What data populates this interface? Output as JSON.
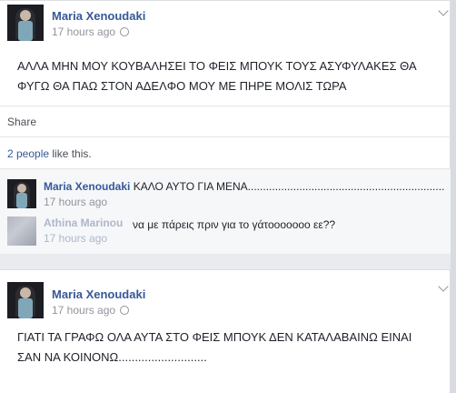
{
  "posts": [
    {
      "author": "Maria Xenoudaki",
      "time": "17 hours ago",
      "text": "ΑΛΛΑ ΜΗΝ ΜΟΥ ΚΟΥΒΑΛΗΣΕΙ ΤΟ ΦΕΙΣ ΜΠΟΥΚ ΤΟΥΣ ΑΣΥΦΥΛΑΚΕΣ ΘΑ\nΦΥΓΩ ΘΑ ΠΑΩ ΣΤΟΝ ΑΔΕΛΦΟ ΜΟΥ ΜΕ ΠΗΡΕ ΜΟΛΙΣ ΤΩΡΑ",
      "share_label": "Share",
      "likes_count": "2 people",
      "likes_suffix": " like this.",
      "comments": [
        {
          "author": "Maria Xenoudaki",
          "text": "ΚΑΛΟ ΑΥΤΟ ΓΙΑ ΜΕΝΑ.................................................................",
          "time": "17 hours ago"
        },
        {
          "author": "Athina Marinou",
          "text": "να με πάρεις πριν για το γάτοοοοοοο εε??",
          "time": "17 hours ago"
        }
      ]
    },
    {
      "author": "Maria Xenoudaki",
      "time": "17 hours ago",
      "text": "ΓΙΑΤΙ ΤΑ ΓΡΑΦΩ ΟΛΑ ΑΥΤΑ ΣΤΟ ΦΕΙΣ ΜΠΟΥΚ ΔΕΝ ΚΑΤΑΛΑΒΑΙΝΩ ΕΙΝΑΙ\nΣΑΝ ΝΑ ΚΟΙΝΟΝΩ..........................."
    }
  ],
  "icons": {
    "privacy": "globe-icon",
    "menu": "chevron-down-icon"
  },
  "colors": {
    "link": "#365899",
    "meta": "#90949c",
    "background": "#e9ebee"
  }
}
